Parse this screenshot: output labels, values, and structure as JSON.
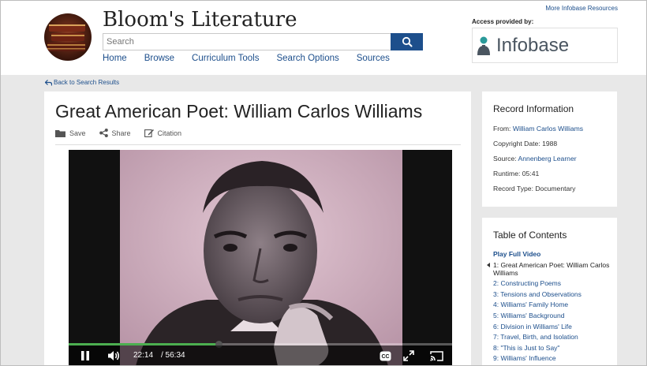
{
  "header": {
    "site_title": "Bloom's Literature",
    "search_placeholder": "Search",
    "more_resources": "More Infobase Resources",
    "access_label": "Access provided by:",
    "provider_name": "Infobase",
    "nav": [
      "Home",
      "Browse",
      "Curriculum Tools",
      "Search Options",
      "Sources"
    ]
  },
  "back_link": "Back to Search Results",
  "main": {
    "title": "Great American Poet: William Carlos Williams",
    "actions": {
      "save": "Save",
      "share": "Share",
      "citation": "Citation"
    }
  },
  "player": {
    "current_time": "22:14",
    "duration": "/ 56:34",
    "progress_fraction": 0.393,
    "progress_color": "#4caf50",
    "icons": [
      "pause-icon",
      "volume-icon",
      "closed-captions-icon",
      "fullscreen-icon",
      "cast-icon"
    ]
  },
  "record_info": {
    "title": "Record Information",
    "from_label": "From:",
    "from_value": "William Carlos Williams",
    "copyright": "Copyright Date: 1988",
    "source_label": "Source:",
    "source_value": "Annenberg Learner",
    "runtime": "Runtime: 05:41",
    "record_type": "Record Type: Documentary"
  },
  "toc": {
    "title": "Table of Contents",
    "play_full": "Play Full Video",
    "items": [
      "1: Great American Poet: William Carlos Williams",
      "2: Constructing Poems",
      "3: Tensions and Observations",
      "4: Williams' Family Home",
      "5: Williams' Background",
      "6: Division in Williams' Life",
      "7: Travel, Birth, and Isolation",
      "8: \"This is Just to Say\"",
      "9: Williams' Influence"
    ]
  },
  "colors": {
    "link": "#1d4f8c",
    "search_button": "#1d4f8c",
    "page_background": "#e8e8e8"
  }
}
